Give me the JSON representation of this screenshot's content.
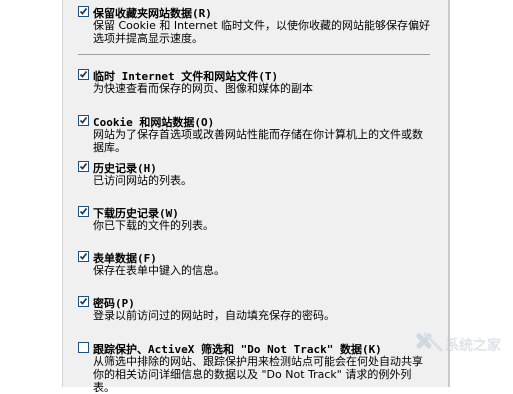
{
  "items": [
    {
      "label": "保留收藏夹网站数据(R)",
      "checked": true,
      "description": "保留 Cookie 和 Internet 临时文件，以使你收藏的网站能够保存偏好选项并提高显示速度。"
    },
    {
      "label": "临时 Internet 文件和网站文件(T)",
      "checked": true,
      "description": "为快速查看而保存的网页、图像和媒体的副本"
    },
    {
      "label": "Cookie 和网站数据(O)",
      "checked": true,
      "description": "网站为了保存首选项或改善网站性能而存储在你计算机上的文件或数据库。"
    },
    {
      "label": "历史记录(H)",
      "checked": true,
      "description": "已访问网站的列表。"
    },
    {
      "label": "下载历史记录(W)",
      "checked": true,
      "description": "你已下载的文件的列表。"
    },
    {
      "label": "表单数据(F)",
      "checked": true,
      "description": "保存在表单中键入的信息。"
    },
    {
      "label": "密码(P)",
      "checked": true,
      "description": "登录以前访问过的网站时，自动填充保存的密码。"
    },
    {
      "label": "跟踪保护、ActiveX 筛选和 \"Do Not Track\" 数据(K)",
      "checked": false,
      "description": "从筛选中排除的网站、跟踪保护用来检测站点可能会在何处自动共享你的相关访问详细信息的数据以及 \"Do Not Track\" 请求的例外列表。"
    }
  ],
  "watermark": {
    "text": "系统之家"
  },
  "colors": {
    "dialog_bg": "#f0f0f0",
    "checkbox_border": "#1c5180"
  }
}
